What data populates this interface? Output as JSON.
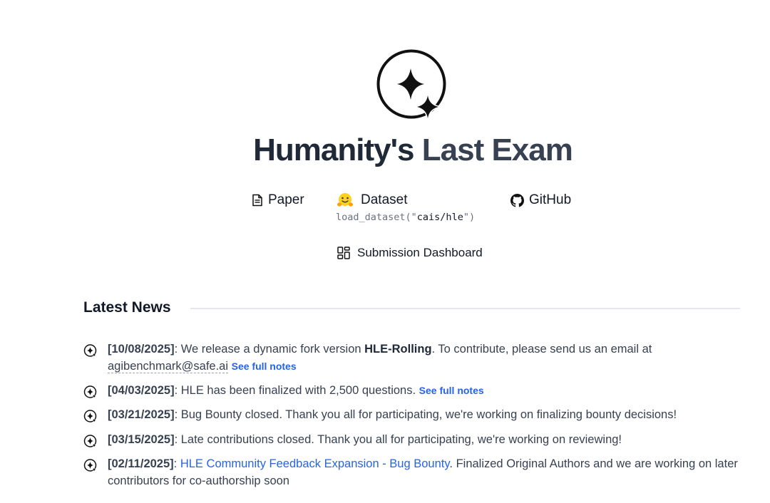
{
  "header": {
    "title_part1": "Humanity's",
    "title_part2": "Last Exam",
    "logo_icon": "sparkle-circle-icon"
  },
  "links": {
    "paper": {
      "label": "Paper",
      "icon": "document-icon"
    },
    "dataset": {
      "label": "Dataset",
      "icon": "hugging-face-icon"
    },
    "dataset_code_prefix": "load_dataset(\"",
    "dataset_code_arg": "cais/hle",
    "dataset_code_suffix": "\")",
    "github": {
      "label": "GitHub",
      "icon": "github-icon"
    },
    "dashboard": {
      "label": "Submission Dashboard",
      "icon": "dashboard-grid-icon"
    }
  },
  "news": {
    "heading": "Latest News",
    "see_full_notes": "See full notes",
    "items": [
      {
        "date": "[10/08/2025]",
        "text1": ": We release a dynamic fork version ",
        "bold": "HLE-Rolling",
        "text2": ". To contribute, please send us an email at ",
        "email": "agibenchmark@safe.ai"
      },
      {
        "date": "[04/03/2025]",
        "text1": ": HLE has been finalized with 2,500 questions."
      },
      {
        "date": "[03/21/2025]",
        "text1": ": Bug Bounty closed. Thank you all for participating, we're working on finalizing bounty decisions!"
      },
      {
        "date": "[03/15/2025]",
        "text1": ": Late contributions closed. Thank you all for participating, we're working on reviewing!"
      },
      {
        "date": "[02/11/2025]",
        "text1": ": ",
        "link": "HLE Community Feedback Expansion - Bug Bounty",
        "text2": ". Finalized Original Authors and we are working on later contributors for co-authorship soon"
      }
    ]
  }
}
